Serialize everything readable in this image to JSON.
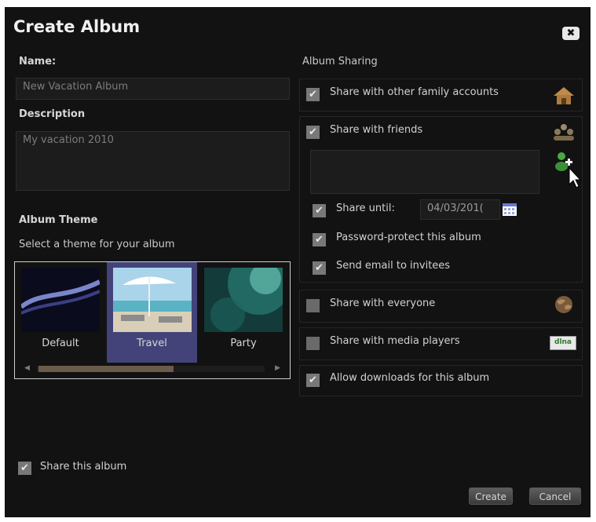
{
  "dialog": {
    "title": "Create Album",
    "close_label": "✖"
  },
  "left": {
    "name_label": "Name:",
    "name_value": "New Vacation Album",
    "description_label": "Description",
    "description_value": "My vacation 2010",
    "theme_heading": "Album Theme",
    "theme_prompt": "Select a theme for your album",
    "themes": [
      {
        "label": "Default",
        "selected": false
      },
      {
        "label": "Travel",
        "selected": true
      },
      {
        "label": "Party",
        "selected": false
      }
    ],
    "share_album_label": "Share this album",
    "share_album_checked": true
  },
  "sharing": {
    "heading": "Album Sharing",
    "family_label": "Share with other family accounts",
    "family_checked": true,
    "friends_label": "Share with friends",
    "friends_checked": true,
    "share_until_label": "Share until:",
    "share_until_checked": true,
    "share_until_date": "04/03/201(",
    "password_label": "Password-protect this album",
    "password_checked": true,
    "email_label": "Send email to invitees",
    "email_checked": true,
    "everyone_label": "Share with everyone",
    "everyone_checked": false,
    "media_label": "Share with media players",
    "media_checked": false,
    "media_icon_text": "dlna",
    "downloads_label": "Allow downloads for this album",
    "downloads_checked": true
  },
  "buttons": {
    "create": "Create",
    "cancel": "Cancel"
  },
  "icons": {
    "close": "close-icon",
    "home": "home-icon",
    "friends": "friends-icon",
    "add_friend": "add-friend-icon",
    "calendar": "calendar-icon",
    "globe": "globe-icon",
    "media": "media-player-icon",
    "cursor": "mouse-cursor-icon"
  }
}
